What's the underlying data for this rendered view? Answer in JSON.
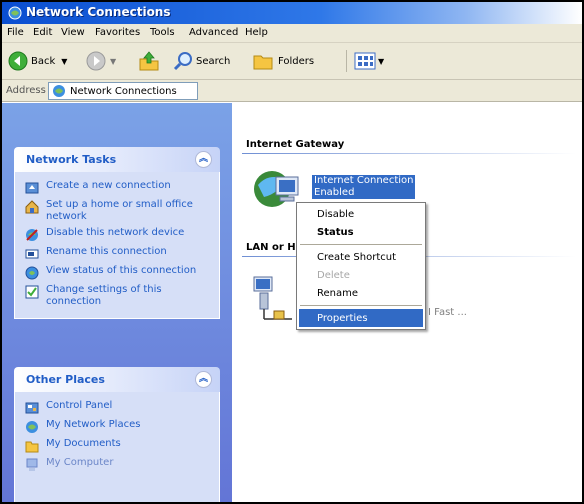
{
  "window": {
    "title": "Network Connections"
  },
  "menu": [
    "File",
    "Edit",
    "View",
    "Favorites",
    "Tools",
    "Advanced",
    "Help"
  ],
  "toolbar": {
    "back": "Back",
    "search": "Search",
    "folders": "Folders"
  },
  "address": {
    "label": "Address",
    "value": "Network Connections"
  },
  "network_tasks": {
    "title": "Network Tasks",
    "items": [
      "Create a new connection",
      "Set up a home or small office network",
      "Disable this network device",
      "Rename this connection",
      "View status of this connection",
      "Change settings of this connection"
    ]
  },
  "other_places": {
    "title": "Other Places",
    "items": [
      "Control Panel",
      "My Network Places",
      "My Documents",
      "My Computer"
    ]
  },
  "groups": {
    "internet_gateway": "Internet Gateway",
    "lan": "LAN or H"
  },
  "gateway_item": {
    "name": "Internet Connection",
    "status": "Enabled"
  },
  "lan_item": {
    "partial": "I Fast ..."
  },
  "context_menu": {
    "items": [
      "Disable",
      "Status",
      "Create Shortcut",
      "Delete",
      "Rename",
      "Properties"
    ]
  },
  "colors": {
    "title_bar": "#0a4ed0",
    "task_pane": "#7ba2e7",
    "selection": "#316ac5",
    "link": "#215dc6"
  }
}
